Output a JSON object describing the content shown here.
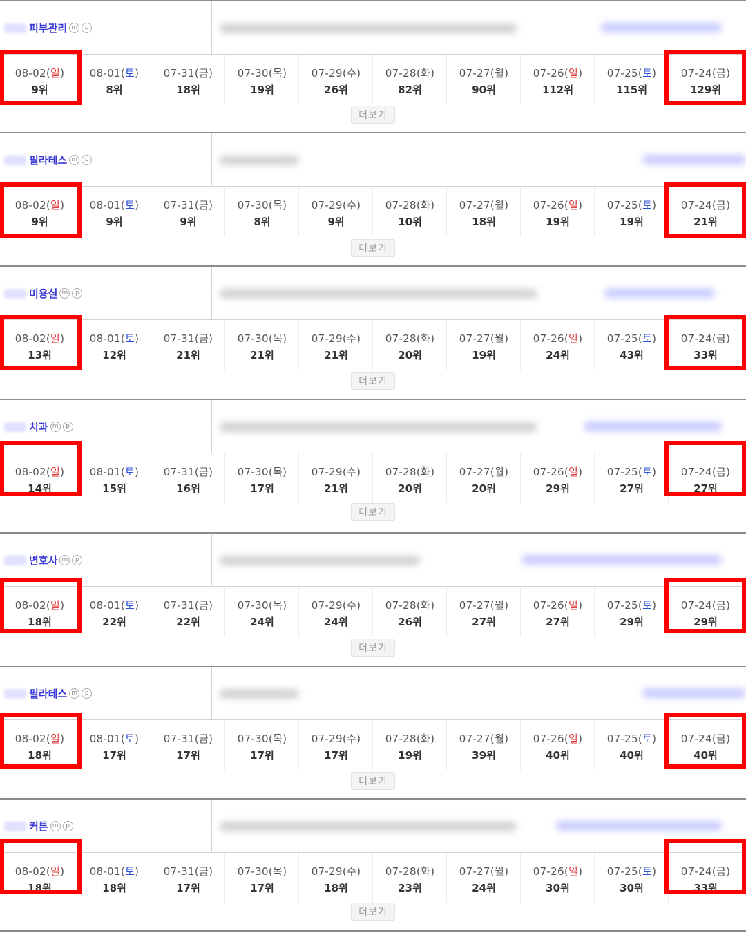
{
  "dates": [
    "08-02",
    "08-01",
    "07-31",
    "07-30",
    "07-29",
    "07-28",
    "07-27",
    "07-26",
    "07-25",
    "07-24"
  ],
  "weekdays": [
    "일",
    "토",
    "금",
    "목",
    "수",
    "화",
    "월",
    "일",
    "토",
    "금"
  ],
  "weekday_types": [
    "sun",
    "sat",
    "",
    "",
    "",
    "",
    "",
    "sun",
    "sat",
    ""
  ],
  "more_label": "더보기",
  "badges": [
    "m",
    "p"
  ],
  "colors": {
    "highlight": "#ff0000",
    "keyword": "#3a3ad6",
    "sunday": "#e23b3b",
    "saturday": "#2e52d6"
  },
  "sections": [
    {
      "keyword": "피부관리",
      "ranks": [
        "9위",
        "8위",
        "18위",
        "19위",
        "26위",
        "82위",
        "90위",
        "112위",
        "115위",
        "129위"
      ]
    },
    {
      "keyword": "필라테스",
      "ranks": [
        "9위",
        "9위",
        "9위",
        "8위",
        "9위",
        "10위",
        "18위",
        "19위",
        "19위",
        "21위"
      ]
    },
    {
      "keyword": "미용실",
      "ranks": [
        "13위",
        "12위",
        "21위",
        "21위",
        "21위",
        "20위",
        "19위",
        "24위",
        "43위",
        "33위"
      ]
    },
    {
      "keyword": "치과",
      "ranks": [
        "14위",
        "15위",
        "16위",
        "17위",
        "21위",
        "20위",
        "20위",
        "29위",
        "27위",
        "27위"
      ]
    },
    {
      "keyword": "변호사",
      "ranks": [
        "18위",
        "22위",
        "22위",
        "24위",
        "24위",
        "26위",
        "27위",
        "27위",
        "29위",
        "29위"
      ]
    },
    {
      "keyword": "필라테스",
      "ranks": [
        "18위",
        "17위",
        "17위",
        "17위",
        "17위",
        "19위",
        "39위",
        "40위",
        "40위",
        "40위"
      ]
    },
    {
      "keyword": "커튼",
      "ranks": [
        "18위",
        "18위",
        "17위",
        "17위",
        "18위",
        "23위",
        "24위",
        "30위",
        "30위",
        "33위"
      ]
    }
  ]
}
